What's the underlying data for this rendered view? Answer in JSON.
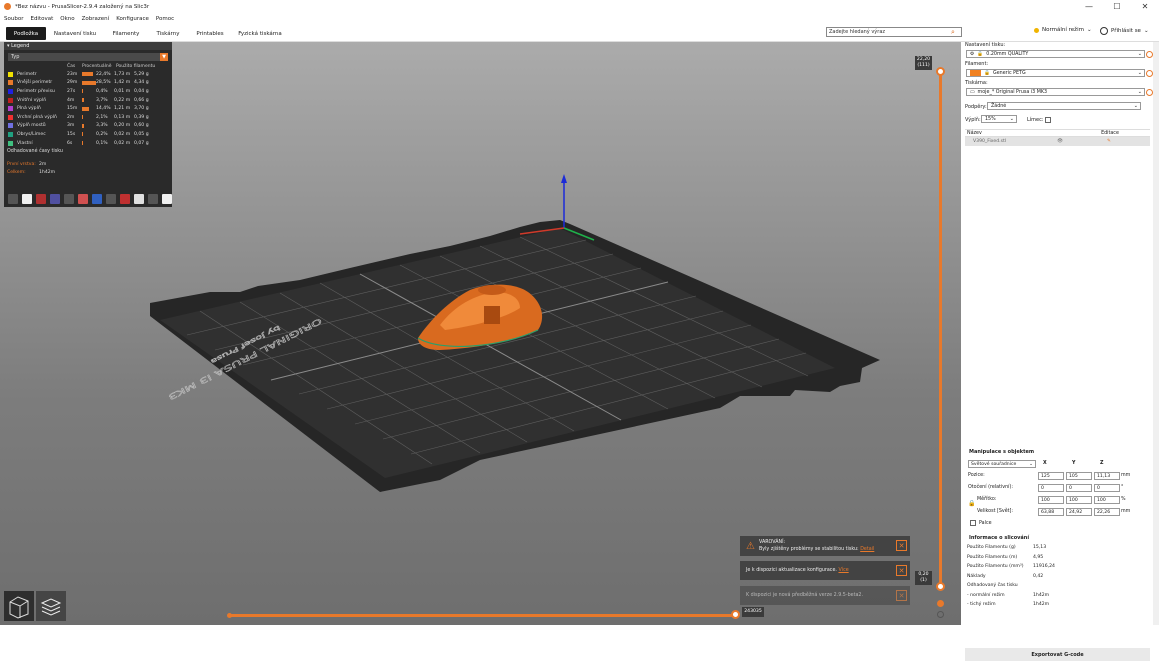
{
  "window": {
    "title": "*Bez názvu - PrusaSlicer-2.9.4 založený na Slic3r",
    "minimize": "—",
    "maximize": "☐",
    "close": "✕"
  },
  "menu": [
    "Soubor",
    "Editovat",
    "Okno",
    "Zobrazení",
    "Konfigurace",
    "Pomoc"
  ],
  "tabs": [
    "Podložka",
    "Nastavení tisku",
    "Filamenty",
    "Tiskárny",
    "Printables",
    "Fyzická tiskárna"
  ],
  "active_tab": 0,
  "search": {
    "placeholder": "Zadejte hledaný výraz"
  },
  "mode": {
    "label": "Normální režim"
  },
  "login": {
    "label": "Přihlásit se"
  },
  "legend": {
    "title": "Legend",
    "type_label": "Typ",
    "columns": [
      "",
      "Čas",
      "Procentuálně",
      "Použito filamentu"
    ],
    "rows": [
      {
        "name": "Perimetr",
        "time": "23m",
        "pct": "22,4%",
        "length": "1,73 m",
        "weight": "5,29 g",
        "color": "#f0e000",
        "frac": 0.224
      },
      {
        "name": "Vnější perimetr",
        "time": "29m",
        "pct": "28,5%",
        "length": "1,42 m",
        "weight": "4,34 g",
        "color": "#e8792b",
        "frac": 0.285
      },
      {
        "name": "Perimetr převisu",
        "time": "27s",
        "pct": "0,4%",
        "length": "0,01 m",
        "weight": "0,04 g",
        "color": "#2020e0",
        "frac": 0.004
      },
      {
        "name": "Vnitřní výplň",
        "time": "4m",
        "pct": "3,7%",
        "length": "0,22 m",
        "weight": "0,66 g",
        "color": "#c02020",
        "frac": 0.037
      },
      {
        "name": "Plná výplň",
        "time": "15m",
        "pct": "14,4%",
        "length": "1,21 m",
        "weight": "3,70 g",
        "color": "#b040d0",
        "frac": 0.144
      },
      {
        "name": "Vrchní plná výplň",
        "time": "2m",
        "pct": "2,1%",
        "length": "0,13 m",
        "weight": "0,39 g",
        "color": "#f03030",
        "frac": 0.021
      },
      {
        "name": "Výplň mostů",
        "time": "3m",
        "pct": "3,3%",
        "length": "0,20 m",
        "weight": "0,60 g",
        "color": "#7070e0",
        "frac": 0.033
      },
      {
        "name": "Obrys/Límec",
        "time": "15s",
        "pct": "0,2%",
        "length": "0,02 m",
        "weight": "0,05 g",
        "color": "#20a080",
        "frac": 0.002
      },
      {
        "name": "Vlastní",
        "time": "6s",
        "pct": "0,1%",
        "length": "0,02 m",
        "weight": "0,07 g",
        "color": "#40c080",
        "frac": 0.001
      }
    ],
    "estimate_title": "Odhadované časy tisku",
    "first_layer": {
      "k": "První vrstva:",
      "v": "2m"
    },
    "total": {
      "k": "Celkem:",
      "v": "1h42m"
    }
  },
  "bed_text": [
    "ORIGINAL PRUSA i3 MK3",
    "by Josef Prusa"
  ],
  "vslider": {
    "top": "22,20\n(111)",
    "bottom": "0,20\n(1)"
  },
  "hslider": {
    "value": "243035"
  },
  "notifications": {
    "warning_title": "VAROVÁNÍ:",
    "warning_text": "Byly zjištěny problémy se stabilitou tisku:",
    "warning_link": "Detail",
    "config_text": "Je k dispozici aktualizace konfigurace.",
    "config_link": "Více",
    "version_text": "K dispozici je nová předběžná verze 2.9.5-beta2."
  },
  "right": {
    "print_settings_label": "Nastavení tisku:",
    "print_settings": "0.20mm QUALITY",
    "filament_label": "Filament:",
    "filament": "Generic PETG",
    "filament_color": "#f08020",
    "printer_label": "Tiskárna:",
    "printer": "moje_* Original Prusa i3 MK3",
    "supports_label": "Podpěry:",
    "supports": "Žádné",
    "infill_label": "Výplň:",
    "infill": "15%",
    "brim_label": "Límec:",
    "table_headers": [
      "Název",
      "Editace"
    ],
    "object": "V390_Fixed.stl"
  },
  "manip": {
    "title": "Manipulace s objektem",
    "coords": "Světové souřadnice",
    "axes": [
      "X",
      "Y",
      "Z"
    ],
    "position_label": "Pozice:",
    "position": [
      "125",
      "105",
      "11,13"
    ],
    "rotation_label": "Otočení (relativní):",
    "rotation": [
      "0",
      "0",
      "0"
    ],
    "scale_label": "Měřítko:",
    "scale": [
      "100",
      "100",
      "100"
    ],
    "size_label": "Velikost [Svět]:",
    "size": [
      "63,88",
      "24,92",
      "22,26"
    ],
    "unit_mm": "mm",
    "unit_deg": "°",
    "unit_pct": "%",
    "inches_label": "Palce"
  },
  "info": {
    "title": "Informace o slicování",
    "rows": [
      {
        "k": "Použito Filamentu (g)",
        "v": "15,13"
      },
      {
        "k": "Použito Filamentu (m)",
        "v": "4,95"
      },
      {
        "k": "Použito Filamentu (mm³)",
        "v": "11916,24"
      },
      {
        "k": "Náklady",
        "v": "0,42"
      },
      {
        "k": "Odhadovaný čas tisku",
        "v": ""
      },
      {
        "k": "- normální režim",
        "v": "1h42m"
      },
      {
        "k": "- tichý režim",
        "v": "1h42m"
      }
    ]
  },
  "export_label": "Exportovat G-code"
}
